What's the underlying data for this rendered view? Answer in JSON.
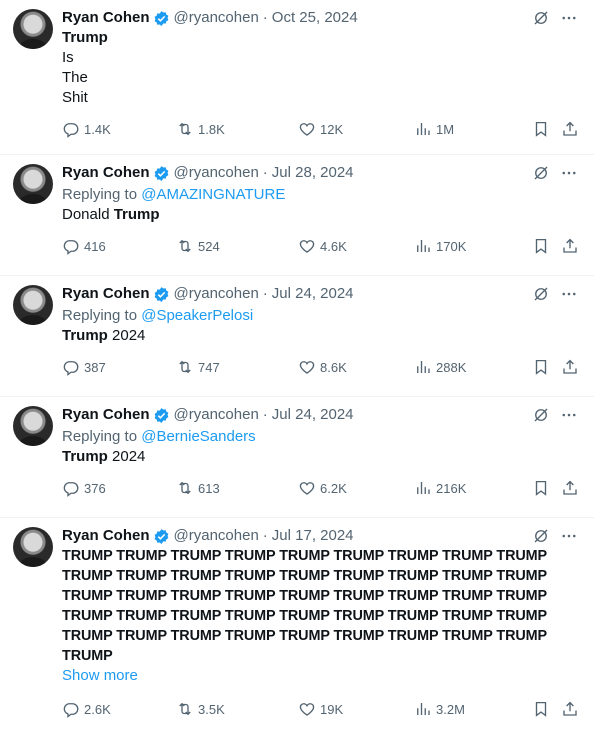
{
  "tweets": [
    {
      "name": "Ryan Cohen",
      "handle": "@ryancohen",
      "date": "Oct 25, 2024",
      "lines": [
        {
          "text": "Trump",
          "bold": true
        },
        {
          "text": "Is",
          "bold": false
        },
        {
          "text": "The",
          "bold": false
        },
        {
          "text": "Shit",
          "bold": false
        }
      ],
      "replies": "1.4K",
      "reposts": "1.8K",
      "likes": "12K",
      "views": "1M"
    },
    {
      "name": "Ryan Cohen",
      "handle": "@ryancohen",
      "date": "Jul 28, 2024",
      "replying_label": "Replying to",
      "replying_to": "@AMAZINGNATURE",
      "text_plain": "Donald",
      "text_bold": "Trump",
      "replies": "416",
      "reposts": "524",
      "likes": "4.6K",
      "views": "170K"
    },
    {
      "name": "Ryan Cohen",
      "handle": "@ryancohen",
      "date": "Jul 24, 2024",
      "replying_label": "Replying to",
      "replying_to": "@SpeakerPelosi",
      "text_bold": "Trump",
      "text_plain": "2024",
      "replies": "387",
      "reposts": "747",
      "likes": "8.6K",
      "views": "288K"
    },
    {
      "name": "Ryan Cohen",
      "handle": "@ryancohen",
      "date": "Jul 24, 2024",
      "replying_label": "Replying to",
      "replying_to": "@BernieSanders",
      "text_bold": "Trump",
      "text_plain": "2024",
      "replies": "376",
      "reposts": "613",
      "likes": "6.2K",
      "views": "216K"
    },
    {
      "name": "Ryan Cohen",
      "handle": "@ryancohen",
      "date": "Jul 17, 2024",
      "caps_lines": [
        "TRUMP TRUMP TRUMP TRUMP TRUMP TRUMP TRUMP TRUMP TRUMP",
        "TRUMP TRUMP TRUMP TRUMP TRUMP TRUMP TRUMP TRUMP TRUMP",
        "TRUMP TRUMP TRUMP TRUMP TRUMP TRUMP TRUMP TRUMP TRUMP",
        "TRUMP TRUMP TRUMP TRUMP TRUMP TRUMP TRUMP TRUMP TRUMP",
        "TRUMP TRUMP TRUMP TRUMP TRUMP TRUMP TRUMP TRUMP TRUMP",
        "TRUMP"
      ],
      "show_more": "Show more",
      "replies": "2.6K",
      "reposts": "3.5K",
      "likes": "19K",
      "views": "3.2M"
    }
  ],
  "separator": "·",
  "icons": {
    "verified": "verified-badge-icon",
    "grok": "grok-icon",
    "more": "more-icon",
    "reply": "reply-icon",
    "repost": "repost-icon",
    "like": "like-icon",
    "views": "views-icon",
    "bookmark": "bookmark-icon",
    "share": "share-icon"
  },
  "colors": {
    "accent": "#1d9bf0",
    "muted": "#536471",
    "text": "#0f1419",
    "border": "#eff3f4"
  }
}
